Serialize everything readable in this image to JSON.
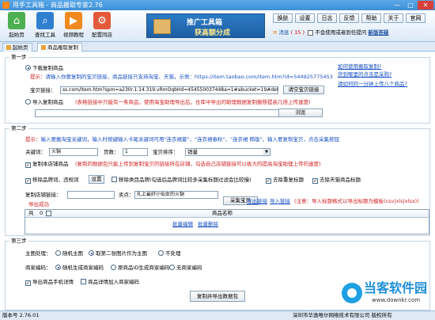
{
  "window": {
    "title": "甩手工具箱 - 商品搬取专家2.76",
    "min": "—",
    "max": "□",
    "close": "✕"
  },
  "toolbar": {
    "buttons": [
      {
        "label": "起始页",
        "icon": "home-icon",
        "color": "#4caf50"
      },
      {
        "label": "查找工具",
        "icon": "search-icon",
        "color": "#2f7fd1"
      },
      {
        "label": "视频教程",
        "icon": "video-icon",
        "color": "#f08a20"
      },
      {
        "label": "配置同店",
        "icon": "config-icon",
        "color": "#e25a3a"
      }
    ],
    "banner": {
      "line1": "推广工具箱",
      "line2": "获高额分成"
    },
    "top_buttons": [
      "换肤",
      "设置",
      "日志",
      "反馈",
      "帮助",
      "关于",
      "官网"
    ],
    "messages_label": "消息",
    "messages_count": "( 15 )",
    "no_fill_label": "不会使用或者到任提问",
    "bold_link": "新版答疑"
  },
  "tabs": [
    "起始页",
    "商品搬取复制"
  ],
  "step1": {
    "legend": "第一步",
    "help_link": "如何使用搬取复制?",
    "radio_download": "下载复制商品",
    "help_link2": "货到哪里的点击是采购?",
    "hint_label": "提示",
    "hint_text": "请输入你要复制的宝贝链接，商品链接只支持淘宝、天猫，示例：",
    "hint_example": "https://item.taobao.com/item.htm?id=544925775453",
    "help_link3": "请如何同一分钟上传八个商品?",
    "url_label": "宝贝链接：",
    "url_value": "ss.com/item.htm?spm=a230r.1.14.319.vRmOqbHd=454550037448a=1#abucket=19#detail",
    "url_button": "请空宝贝链接",
    "radio_import": "导入复制商品",
    "import_hint": "(表格链接中只能有一条商品，使用淘宝助理导出后，仓库中导出的助理数据复制搬移提高几倍上传速度)",
    "browse_button": "浏览"
  },
  "step2": {
    "legend": "第二步",
    "hint_label": "提示",
    "hint_text": "输入要搬淘宝关键词，输入时按键输入卡尾关键词可用\"连衣裙夏\"、\"连衣裙春秋\"、\"连衣裙 韩版\"，输入要复制宝贝，点击采集按钮",
    "keyword_label": "关键词：",
    "keyword_value": "火锅",
    "pages_label": "页数：",
    "pages_value": "1",
    "sort_label": "宝贝排序：",
    "sort_value": "销量",
    "dup_label": "复制本店铺商品",
    "dup_hint": "(复制的数据包只能上传到复制宝贝的链接所在店铺，勾选自己店铺链接可以极大的提高淘宝助理上传的速度)",
    "opt_brand": "移除品牌词，违规词",
    "settings_button": "设置",
    "opt_remove_brand": "移除类目品牌(勾选后品牌词比较多采集标题过滤会比较慢)",
    "opt_filter_dup": "去除重复标题",
    "opt_remove_title": "去除天猫商品标题",
    "shop_label": "复制店铺链接：",
    "seller_label": "卖点：",
    "seller_value": "礼上最好小仙女的火锅",
    "collect_button": "采集宝贝",
    "export_link": "导出链接",
    "import_link": "导入链接",
    "import_note": "(注意：导入标题格式以导出标题为模板(csv|xls|xlsx))",
    "export_success": "导出成功",
    "grid_headers": [
      "共",
      "0",
      "商品名称"
    ],
    "batch_edit": "批量编辑",
    "batch_delete": "批量删除"
  },
  "step3": {
    "legend": "第三步",
    "main_img_label": "主图处理：",
    "main_img_opts": [
      "随机主图",
      "取第二张图片作为主图",
      "不处理"
    ],
    "code_label": "商家编码：",
    "code_opts": [
      "随机生成商家编码",
      "原商品ID生成商家编码",
      "无商家编码"
    ],
    "opt_mobile": "导出商品手机详情",
    "opt_shop_code": "商品详情加入商家编码",
    "export_button": "复制并导出数据包"
  },
  "statusbar": {
    "version": "版本号 2.76.01",
    "company": "深圳市华逸唯尔网络技术有限公司 版权所有"
  },
  "watermark": {
    "name": "当客软件园",
    "url": "www.downkr.com"
  }
}
